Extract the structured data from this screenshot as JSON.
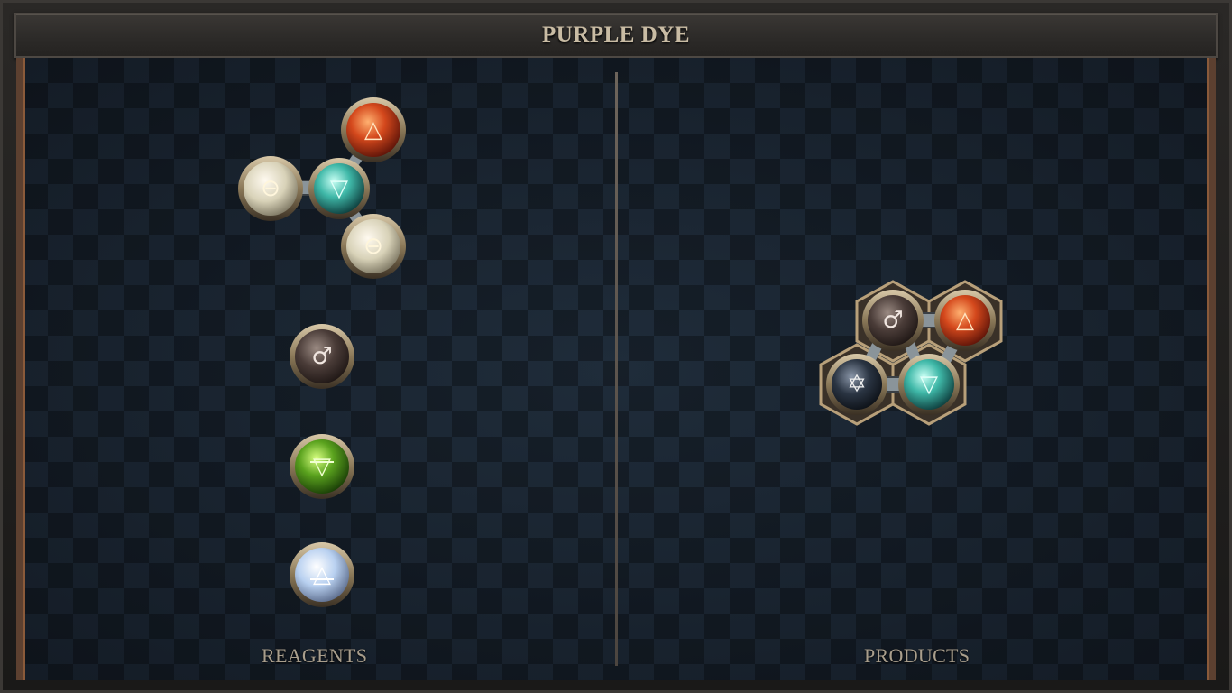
{
  "title": "PURPLE DYE",
  "panels": {
    "reagents": {
      "label": "REAGENTS"
    },
    "products": {
      "label": "PRODUCTS"
    }
  },
  "elements": {
    "fire": {
      "symbol": "🜂",
      "color": "#d4481c"
    },
    "water": {
      "symbol": "🜄",
      "color": "#3fb8a8"
    },
    "salt": {
      "symbol": "🜔",
      "color": "#d8d2b8"
    },
    "iron": {
      "symbol": "♂",
      "color": "#5a4a44"
    },
    "earth": {
      "symbol": "🜃",
      "color": "#5aa21e"
    },
    "air": {
      "symbol": "🜁",
      "color": "#b8d0f0"
    },
    "quintessence": {
      "symbol": "🜀",
      "color": "#2a3442"
    }
  },
  "reagents": [
    {
      "name": "water-salt-fire-salt-molecule",
      "atoms": [
        "water",
        "salt",
        "fire",
        "salt"
      ]
    },
    {
      "name": "iron-atom",
      "atoms": [
        "iron"
      ]
    },
    {
      "name": "earth-atom",
      "atoms": [
        "earth"
      ]
    },
    {
      "name": "air-atom",
      "atoms": [
        "air"
      ]
    }
  ],
  "products": [
    {
      "name": "purple-dye-molecule",
      "atoms": [
        "iron",
        "fire",
        "quintessence",
        "water"
      ]
    }
  ]
}
